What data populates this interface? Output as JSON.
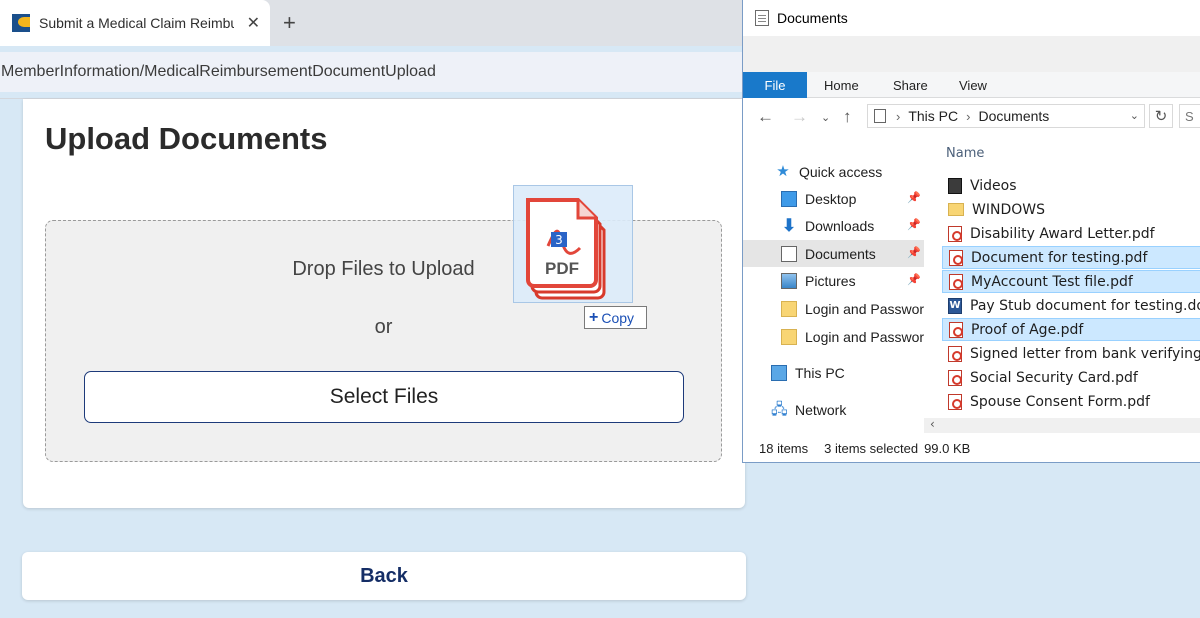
{
  "browser": {
    "tab_title": "Submit a Medical Claim Reimbursement",
    "tab_close": "✕",
    "new_tab": "+",
    "address": "MemberInformation/MedicalReimbursementDocumentUpload"
  },
  "upload": {
    "title": "Upload Documents",
    "drop_text": "Drop Files to Upload",
    "or_text": "or",
    "select_button": "Select Files",
    "back_button": "Back"
  },
  "drag": {
    "badge_count": "3",
    "file_label": "PDF",
    "tip_icon": "+",
    "tip_label": "Copy"
  },
  "explorer": {
    "window_title": "Documents",
    "ribbon_tabs": [
      "File",
      "Home",
      "Share",
      "View"
    ],
    "path": [
      "This PC",
      "Documents"
    ],
    "search_placeholder": "S",
    "nav_items": [
      {
        "label": "Quick access",
        "icon": "star-icon"
      },
      {
        "label": "Desktop",
        "icon": "desktop-icon"
      },
      {
        "label": "Downloads",
        "icon": "download-icon"
      },
      {
        "label": "Documents",
        "icon": "documents-icon"
      },
      {
        "label": "Pictures",
        "icon": "pictures-icon"
      },
      {
        "label": "Login and Password",
        "icon": "folder-icon"
      },
      {
        "label": "Login and Password",
        "icon": "folder-icon"
      },
      {
        "label": "This PC",
        "icon": "computer-icon"
      },
      {
        "label": "Network",
        "icon": "network-icon"
      }
    ],
    "column_header": "Name",
    "files": [
      {
        "name": "Videos",
        "type": "video",
        "selected": false
      },
      {
        "name": "WINDOWS",
        "type": "folder",
        "selected": false
      },
      {
        "name": "Disability Award Letter.pdf",
        "type": "pdf",
        "selected": false
      },
      {
        "name": "Document for testing.pdf",
        "type": "pdf",
        "selected": true
      },
      {
        "name": "MyAccount Test file.pdf",
        "type": "pdf",
        "selected": true
      },
      {
        "name": "Pay Stub document for testing.docx",
        "type": "docx",
        "selected": false
      },
      {
        "name": "Proof of Age.pdf",
        "type": "pdf",
        "selected": true
      },
      {
        "name": "Signed letter from bank verifying your",
        "type": "pdf",
        "selected": false
      },
      {
        "name": "Social Security Card.pdf",
        "type": "pdf",
        "selected": false
      },
      {
        "name": "Spouse Consent Form.pdf",
        "type": "pdf",
        "selected": false
      }
    ],
    "status": {
      "item_count": "18 items",
      "selected": "3 items selected",
      "size": "99.0 KB"
    }
  }
}
